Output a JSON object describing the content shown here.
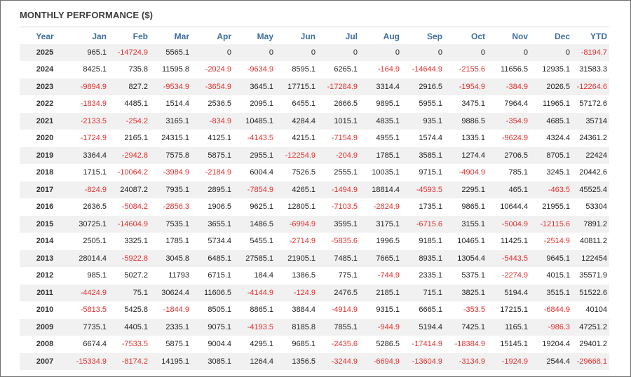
{
  "title": "MONTHLY PERFORMANCE ($)",
  "headers": [
    "Year",
    "Jan",
    "Feb",
    "Mar",
    "Apr",
    "May",
    "Jun",
    "Jul",
    "Aug",
    "Sep",
    "Oct",
    "Nov",
    "Dec",
    "YTD"
  ],
  "rows": [
    [
      "2025",
      "965.1",
      "-14724.9",
      "5565.1",
      "0",
      "0",
      "0",
      "0",
      "0",
      "0",
      "0",
      "0",
      "0",
      "-8194.7"
    ],
    [
      "2024",
      "8425.1",
      "735.8",
      "11595.8",
      "-2024.9",
      "-9634.9",
      "8595.1",
      "6265.1",
      "-164.9",
      "-14644.9",
      "-2155.6",
      "11656.5",
      "12935.1",
      "31583.3"
    ],
    [
      "2023",
      "-9894.9",
      "827.2",
      "-9534.9",
      "-3654.9",
      "3645.1",
      "17715.1",
      "-17284.9",
      "3314.4",
      "2916.5",
      "-1954.9",
      "-384.9",
      "2026.5",
      "-12264.6"
    ],
    [
      "2022",
      "-1834.9",
      "4485.1",
      "1514.4",
      "2536.5",
      "2095.1",
      "6455.1",
      "2666.5",
      "9895.1",
      "5955.1",
      "3475.1",
      "7964.4",
      "11965.1",
      "57172.6"
    ],
    [
      "2021",
      "-2133.5",
      "-254.2",
      "3165.1",
      "-834.9",
      "10485.1",
      "4284.4",
      "1015.1",
      "4835.1",
      "935.1",
      "9886.5",
      "-354.9",
      "4685.1",
      "35714"
    ],
    [
      "2020",
      "-1724.9",
      "2165.1",
      "24315.1",
      "4125.1",
      "-4143.5",
      "4215.1",
      "-7154.9",
      "4955.1",
      "1574.4",
      "1335.1",
      "-9624.9",
      "4324.4",
      "24361.2"
    ],
    [
      "2019",
      "3364.4",
      "-2942.8",
      "7575.8",
      "5875.1",
      "2955.1",
      "-12254.9",
      "-204.9",
      "1785.1",
      "3585.1",
      "1274.4",
      "2706.5",
      "8705.1",
      "22424"
    ],
    [
      "2018",
      "1715.1",
      "-10064.2",
      "-3984.9",
      "-2184.9",
      "6004.4",
      "7526.5",
      "2555.1",
      "10035.1",
      "9715.1",
      "-4904.9",
      "785.1",
      "3245.1",
      "20442.6"
    ],
    [
      "2017",
      "-824.9",
      "24087.2",
      "7935.1",
      "2895.1",
      "-7854.9",
      "4265.1",
      "-1494.9",
      "18814.4",
      "-4593.5",
      "2295.1",
      "465.1",
      "-463.5",
      "45525.4"
    ],
    [
      "2016",
      "2636.5",
      "-5084.2",
      "-2856.3",
      "1906.5",
      "9625.1",
      "12805.1",
      "-7103.5",
      "-2824.9",
      "1735.1",
      "9865.1",
      "10644.4",
      "21955.1",
      "53304"
    ],
    [
      "2015",
      "30725.1",
      "-14604.9",
      "7535.1",
      "3655.1",
      "1486.5",
      "-6994.9",
      "3595.1",
      "3175.1",
      "-6715.6",
      "3155.1",
      "-5004.9",
      "-12115.6",
      "7891.2"
    ],
    [
      "2014",
      "2505.1",
      "3325.1",
      "1785.1",
      "5734.4",
      "5455.1",
      "-2714.9",
      "-5835.6",
      "1996.5",
      "9185.1",
      "10465.1",
      "11425.1",
      "-2514.9",
      "40811.2"
    ],
    [
      "2013",
      "28014.4",
      "-5922.8",
      "3045.8",
      "6485.1",
      "27585.1",
      "21905.1",
      "7485.1",
      "7665.1",
      "8935.1",
      "13054.4",
      "-5443.5",
      "9645.1",
      "122454"
    ],
    [
      "2012",
      "985.1",
      "5027.2",
      "11793",
      "6715.1",
      "184.4",
      "1386.5",
      "775.1",
      "-744.9",
      "2335.1",
      "5375.1",
      "-2274.9",
      "4015.1",
      "35571.9"
    ],
    [
      "2011",
      "-4424.9",
      "75.1",
      "30624.4",
      "11606.5",
      "-4144.9",
      "-124.9",
      "2476.5",
      "2185.1",
      "715.1",
      "3825.1",
      "5194.4",
      "3515.1",
      "51522.6"
    ],
    [
      "2010",
      "-5813.5",
      "5425.8",
      "-1844.9",
      "8505.1",
      "8865.1",
      "3884.4",
      "-4914.9",
      "9315.1",
      "6665.1",
      "-353.5",
      "17215.1",
      "-6844.9",
      "40104"
    ],
    [
      "2009",
      "7735.1",
      "4405.1",
      "2335.1",
      "9075.1",
      "-4193.5",
      "8185.8",
      "7855.1",
      "-944.9",
      "5194.4",
      "7425.1",
      "1165.1",
      "-986.3",
      "47251.2"
    ],
    [
      "2008",
      "6674.4",
      "-7533.5",
      "5875.1",
      "9004.4",
      "4295.1",
      "9685.1",
      "-2435.6",
      "5286.5",
      "-17414.9",
      "-18384.9",
      "15145.1",
      "19204.4",
      "29401.2"
    ],
    [
      "2007",
      "-15334.9",
      "-8174.2",
      "14195.1",
      "3085.1",
      "1264.4",
      "1356.5",
      "-3244.9",
      "-6694.9",
      "-13604.9",
      "-3134.9",
      "-1924.9",
      "2544.4",
      "-29668.1"
    ]
  ],
  "colors": {
    "header": "#3d6f9f",
    "negative": "#e3312e",
    "stripe": "#f1f1f1"
  }
}
